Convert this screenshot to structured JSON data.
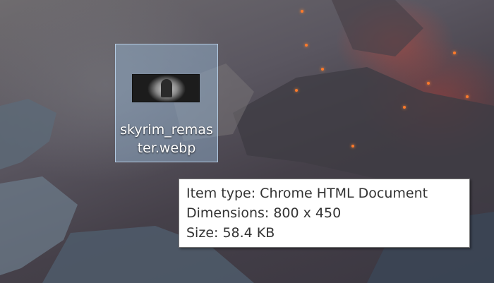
{
  "desktop": {
    "file": {
      "name": "skyrim_remaster.webp",
      "thumbnail_icon": "image-thumbnail-icon"
    },
    "tooltip": {
      "item_type": "Item type: Chrome HTML Document",
      "dimensions": "Dimensions: 800 x 450",
      "size": "Size: 58.4 KB"
    }
  },
  "colors": {
    "selection_fill": "#96b9d7",
    "selection_border": "#bed7f0",
    "tooltip_bg": "#ffffff",
    "tooltip_text": "#333333"
  }
}
